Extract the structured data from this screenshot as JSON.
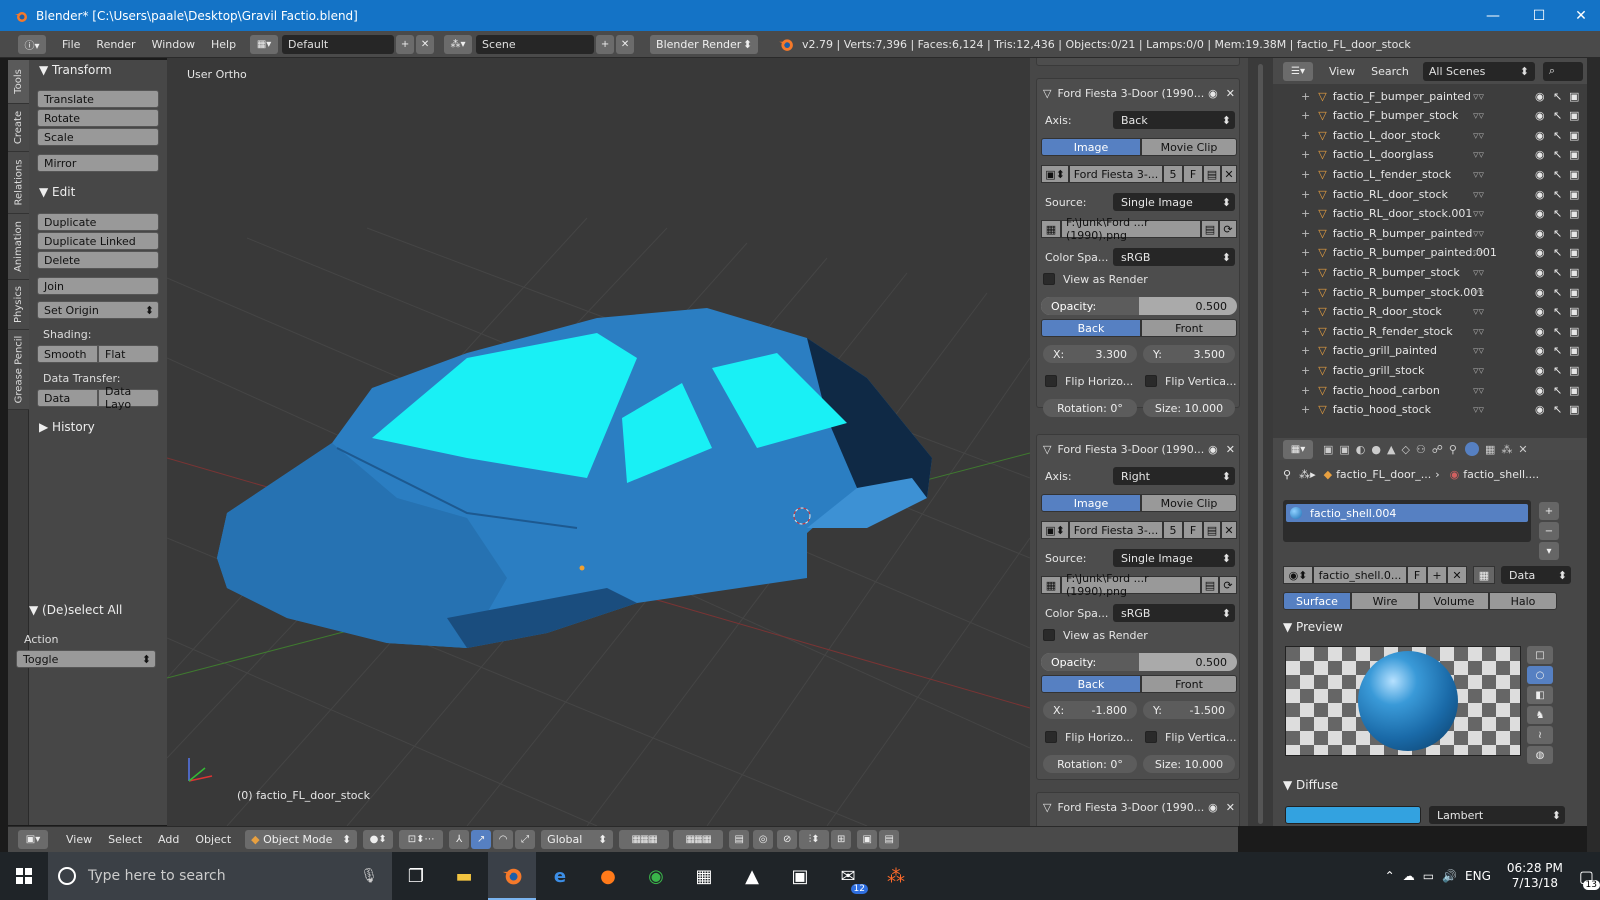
{
  "window": {
    "title": "Blender* [C:\\Users\\paale\\Desktop\\Gravil Factio.blend]",
    "minimize": "—",
    "maximize": "☐",
    "close": "✕"
  },
  "menu": {
    "file": "File",
    "render": "Render",
    "window": "Window",
    "help": "Help"
  },
  "header": {
    "layout": "Default",
    "scene": "Scene",
    "engine": "Blender Render",
    "stats": "v2.79 | Verts:7,396 | Faces:6,124 | Tris:12,436 | Objects:0/21 | Lamps:0/0 | Mem:19.38M | factio_FL_door_stock"
  },
  "tabs": [
    "Tools",
    "Create",
    "Relations",
    "Animation",
    "Physics",
    "Grease Pencil"
  ],
  "toolshelf": {
    "transform": "Transform",
    "translate": "Translate",
    "rotate": "Rotate",
    "scale": "Scale",
    "mirror": "Mirror",
    "edit": "Edit",
    "duplicate": "Duplicate",
    "duplicate_linked": "Duplicate Linked",
    "delete": "Delete",
    "join": "Join",
    "set_origin": "Set Origin",
    "shading": "Shading:",
    "smooth": "Smooth",
    "flat": "Flat",
    "data_transfer": "Data Transfer:",
    "data": "Data",
    "data_layout": "Data Layo",
    "history": "History",
    "op_title": "(De)select All",
    "action": "Action",
    "toggle": "Toggle"
  },
  "viewport": {
    "view_name": "User Ortho",
    "object_label": "(0) factio_FL_door_stock"
  },
  "bg_images": [
    {
      "title": "Ford Fiesta 3-Door (1990...",
      "axis_label": "Axis:",
      "axis": "Back",
      "image": "Image",
      "movie_clip": "Movie Clip",
      "img_name": "Ford Fiesta 3-...",
      "users": "5",
      "fake": "F",
      "source_label": "Source:",
      "source": "Single Image",
      "path": "F:\\Junk\\Ford ...r (1990).png",
      "colorspace_label": "Color Spa...",
      "colorspace": "sRGB",
      "view_as_render": "View as Render",
      "opacity_label": "Opacity:",
      "opacity": "0.500",
      "opacity_frac": 0.5,
      "back": "Back",
      "front": "Front",
      "x_label": "X:",
      "x": "3.300",
      "y_label": "Y:",
      "y": "3.500",
      "flip_h": "Flip Horizo...",
      "flip_v": "Flip Vertica...",
      "rotation_label": "Rotation:",
      "rotation": "0°",
      "size_label": "Size:",
      "size": "10.000"
    },
    {
      "title": "Ford Fiesta 3-Door (1990...",
      "axis_label": "Axis:",
      "axis": "Right",
      "image": "Image",
      "movie_clip": "Movie Clip",
      "img_name": "Ford Fiesta 3-...",
      "users": "5",
      "fake": "F",
      "source_label": "Source:",
      "source": "Single Image",
      "path": "F:\\Junk\\Ford ...r (1990).png",
      "colorspace_label": "Color Spa...",
      "colorspace": "sRGB",
      "view_as_render": "View as Render",
      "opacity_label": "Opacity:",
      "opacity": "0.500",
      "opacity_frac": 0.5,
      "back": "Back",
      "front": "Front",
      "x_label": "X:",
      "x": "-1.800",
      "y_label": "Y:",
      "y": "-1.500",
      "flip_h": "Flip Horizo...",
      "flip_v": "Flip Vertica...",
      "rotation_label": "Rotation:",
      "rotation": "0°",
      "size_label": "Size:",
      "size": "10.000"
    }
  ],
  "bg_third_title": "Ford Fiesta 3-Door (1990...",
  "outliner": {
    "view": "View",
    "search": "Search",
    "scenes": "All Scenes",
    "items": [
      "factio_F_bumper_painted",
      "factio_F_bumper_stock",
      "factio_L_door_stock",
      "factio_L_doorglass",
      "factio_L_fender_stock",
      "factio_RL_door_stock",
      "factio_RL_door_stock.001",
      "factio_R_bumper_painted",
      "factio_R_bumper_painted.001",
      "factio_R_bumper_stock",
      "factio_R_bumper_stock.001",
      "factio_R_door_stock",
      "factio_R_fender_stock",
      "factio_grill_painted",
      "factio_grill_stock",
      "factio_hood_carbon",
      "factio_hood_stock"
    ]
  },
  "properties": {
    "crumb_obj": "factio_FL_door_...",
    "crumb_mat": "factio_shell....",
    "slot": "factio_shell.004",
    "mat_name": "factio_shell.0...",
    "fake": "F",
    "link": "Data",
    "tabs": [
      "Surface",
      "Wire",
      "Volume",
      "Halo"
    ],
    "preview": "Preview",
    "diffuse": "Diffuse",
    "shader": "Lambert"
  },
  "bottom": {
    "view": "View",
    "select": "Select",
    "add": "Add",
    "object": "Object",
    "mode": "Object Mode",
    "orientation": "Global"
  },
  "taskbar": {
    "search": "Type here to search",
    "lang": "ENG",
    "time": "06:28 PM",
    "date": "7/13/18",
    "mail_badge": "12",
    "notif": "13"
  },
  "colors": {
    "accent": "#5680c2",
    "car": "#2b7ec2",
    "glass": "#19f0f5",
    "titlebar": "#1473c6"
  }
}
